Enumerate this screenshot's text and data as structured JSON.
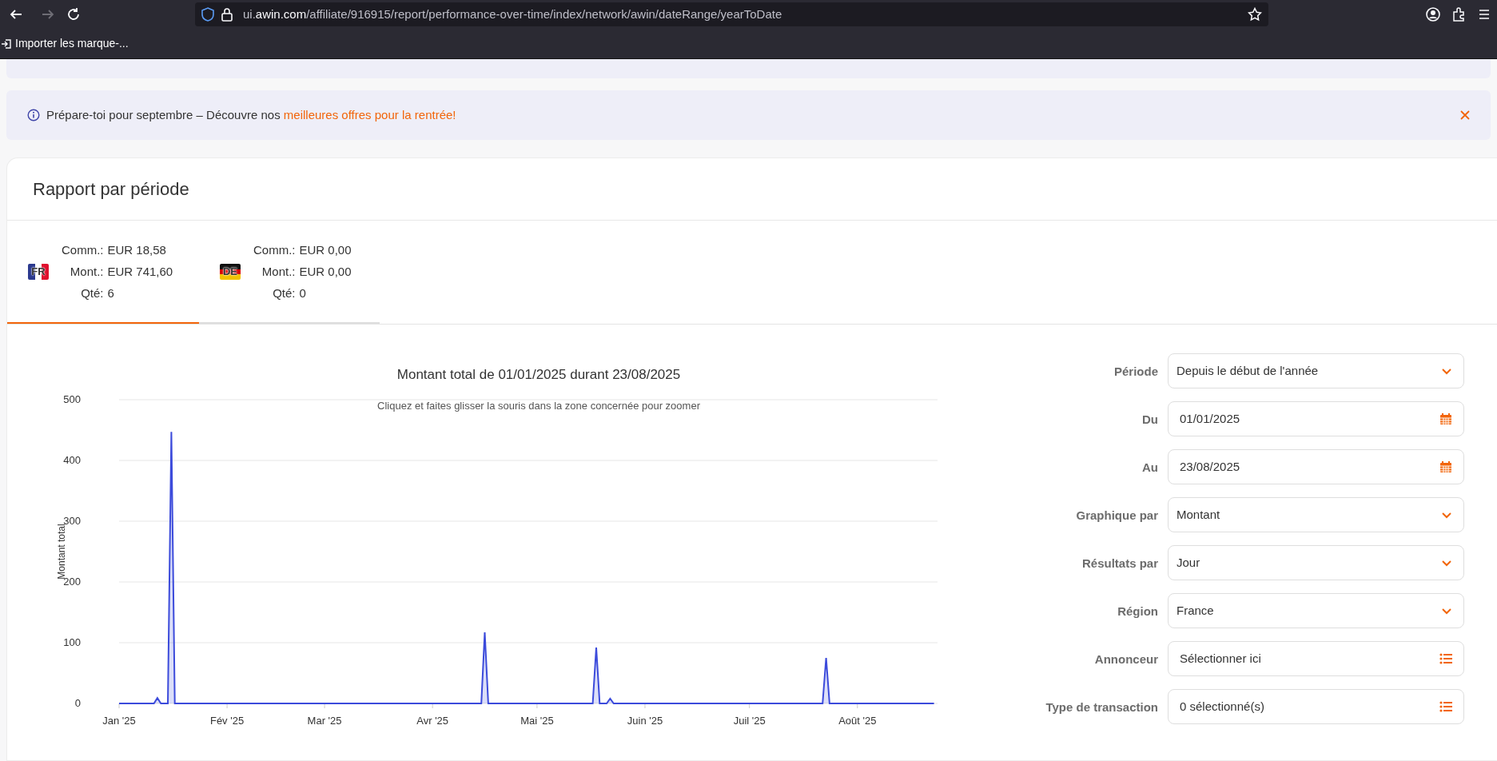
{
  "browser": {
    "url": "ui.**awin.com**/affiliate/916915/report/performance-over-time/index/network/awin/dateRange/yearToDate",
    "forward_disabled": true,
    "bookmarks": [
      "Importer les marque-..."
    ]
  },
  "alert": {
    "text": "Prépare-toi pour septembre – Découvre nos ",
    "link": "meilleures offres pour la rentrée!"
  },
  "report": {
    "title": "Rapport par période",
    "tabs": [
      {
        "code": "FR",
        "selected": true,
        "stats": [
          {
            "label": "Comm.:",
            "value": "EUR 18,58"
          },
          {
            "label": "Mont.:",
            "value": "EUR 741,60"
          },
          {
            "label": "Qté:",
            "value": "6"
          }
        ]
      },
      {
        "code": "DE",
        "selected": false,
        "stats": [
          {
            "label": "Comm.:",
            "value": "EUR 0,00"
          },
          {
            "label": "Mont.:",
            "value": "EUR 0,00"
          },
          {
            "label": "Qté:",
            "value": "0"
          }
        ]
      }
    ],
    "chart": {
      "subtitle": "Cliquez et faites glisser la souris dans la zone concernée pour zoomer",
      "chart_data": {
        "type": "area",
        "title": "Montant total de 01/01/2025 durant 23/08/2025",
        "ylabel": "Montant total",
        "categories": [
          "Jan '25",
          null,
          null,
          null,
          null,
          null,
          null,
          null,
          null,
          null,
          null,
          null,
          null,
          null,
          null,
          null,
          null,
          null,
          null,
          null,
          null,
          null,
          null,
          null,
          null,
          null,
          null,
          null,
          null,
          null,
          null,
          "Fév '25",
          null,
          null,
          null,
          null,
          null,
          null,
          null,
          null,
          null,
          null,
          null,
          null,
          null,
          null,
          null,
          null,
          null,
          null,
          null,
          null,
          null,
          null,
          null,
          null,
          null,
          null,
          null,
          "Mar '25",
          null,
          null,
          null,
          null,
          null,
          null,
          null,
          null,
          null,
          null,
          null,
          null,
          null,
          null,
          null,
          null,
          null,
          null,
          null,
          null,
          null,
          null,
          null,
          null,
          null,
          null,
          null,
          null,
          null,
          null,
          "Avr '25",
          null,
          null,
          null,
          null,
          null,
          null,
          null,
          null,
          null,
          null,
          null,
          null,
          null,
          null,
          null,
          null,
          null,
          null,
          null,
          null,
          null,
          null,
          null,
          null,
          null,
          null,
          null,
          null,
          null,
          "Mai '25",
          null,
          null,
          null,
          null,
          null,
          null,
          null,
          null,
          null,
          null,
          null,
          null,
          null,
          null,
          null,
          null,
          null,
          null,
          null,
          null,
          null,
          null,
          null,
          null,
          null,
          null,
          null,
          null,
          null,
          null,
          "Juin '25",
          null,
          null,
          null,
          null,
          null,
          null,
          null,
          null,
          null,
          null,
          null,
          null,
          null,
          null,
          null,
          null,
          null,
          null,
          null,
          null,
          null,
          null,
          null,
          null,
          null,
          null,
          null,
          null,
          null,
          "Juil '25",
          null,
          null,
          null,
          null,
          null,
          null,
          null,
          null,
          null,
          null,
          null,
          null,
          null,
          null,
          null,
          null,
          null,
          null,
          null,
          null,
          null,
          null,
          null,
          null,
          null,
          null,
          null,
          null,
          null,
          null,
          "Août '25",
          null,
          null,
          null,
          null,
          null,
          null,
          null,
          null,
          null,
          null,
          null,
          null,
          null,
          null,
          null,
          null,
          null,
          null,
          null,
          null,
          null,
          null
        ],
        "series": [
          {
            "color": "#3c4bdb",
            "values": [
              0,
              0,
              0,
              0,
              0,
              0,
              0,
              0,
              0,
              0,
              0,
              9,
              0,
              0,
              0,
              447,
              0,
              0,
              0,
              0,
              0,
              0,
              0,
              0,
              0,
              0,
              0,
              0,
              0,
              0,
              0,
              0,
              0,
              0,
              0,
              0,
              0,
              0,
              0,
              0,
              0,
              0,
              0,
              0,
              0,
              0,
              0,
              0,
              0,
              0,
              0,
              0,
              0,
              0,
              0,
              0,
              0,
              0,
              0,
              0,
              0,
              0,
              0,
              0,
              0,
              0,
              0,
              0,
              0,
              0,
              0,
              0,
              0,
              0,
              0,
              0,
              0,
              0,
              0,
              0,
              0,
              0,
              0,
              0,
              0,
              0,
              0,
              0,
              0,
              0,
              0,
              0,
              0,
              0,
              0,
              0,
              0,
              0,
              0,
              0,
              0,
              0,
              0,
              0,
              0,
              117,
              0,
              0,
              0,
              0,
              0,
              0,
              0,
              0,
              0,
              0,
              0,
              0,
              0,
              0,
              0,
              0,
              0,
              0,
              0,
              0,
              0,
              0,
              0,
              0,
              0,
              0,
              0,
              0,
              0,
              0,
              0,
              92,
              0,
              0,
              0,
              8,
              0,
              0,
              0,
              0,
              0,
              0,
              0,
              0,
              0,
              0,
              0,
              0,
              0,
              0,
              0,
              0,
              0,
              0,
              0,
              0,
              0,
              0,
              0,
              0,
              0,
              0,
              0,
              0,
              0,
              0,
              0,
              0,
              0,
              0,
              0,
              0,
              0,
              0,
              0,
              0,
              0,
              0,
              0,
              0,
              0,
              0,
              0,
              0,
              0,
              0,
              0,
              0,
              0,
              0,
              0,
              0,
              0,
              0,
              0,
              0,
              0,
              75,
              0,
              0,
              0,
              0,
              0,
              0,
              0,
              0,
              0,
              0,
              0,
              0,
              0,
              0,
              0,
              0,
              0,
              0,
              0,
              0,
              0,
              0,
              0,
              0,
              0,
              0,
              0,
              0,
              0,
              0,
              0
            ]
          }
        ],
        "grid": true,
        "ylim": [
          0,
          500
        ],
        "yticks": [
          0,
          100,
          200,
          300,
          400,
          500
        ]
      }
    },
    "filters": [
      {
        "label": "Période",
        "kind": "select",
        "value": "Depuis le début de l'année"
      },
      {
        "label": "Du",
        "kind": "date",
        "value": "01/01/2025"
      },
      {
        "label": "Au",
        "kind": "date",
        "value": "23/08/2025"
      },
      {
        "label": "Graphique par",
        "kind": "select",
        "value": "Montant"
      },
      {
        "label": "Résultats par",
        "kind": "select",
        "value": "Jour"
      },
      {
        "label": "Région",
        "kind": "select",
        "value": "France"
      },
      {
        "label": "Annonceur",
        "kind": "multi",
        "value": "Sélectionner ici"
      },
      {
        "label": "Type de transaction",
        "kind": "multi",
        "value": "0 sélectionné(s)"
      }
    ]
  }
}
